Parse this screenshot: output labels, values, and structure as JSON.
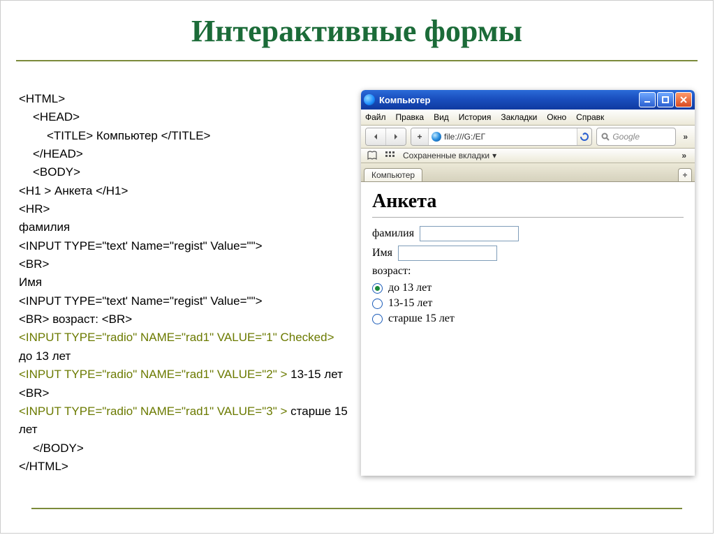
{
  "slide": {
    "title": "Интерактивные формы"
  },
  "code": {
    "l1": "<HTML>",
    "l2": "<HEAD>",
    "l3_a": "<TITLE> ",
    "l3_b": "Компьютер",
    "l3_c": " </TITLE>",
    "l4": "</HEAD>",
    "l5": "<BODY>",
    "l6_a": "<H1 > ",
    "l6_b": "Анкета",
    "l6_c": " </H1>",
    "l7": "<HR>",
    "l8": "фамилия",
    "l9": "<INPUT TYPE=\"text' Name=\"regist\" Value=\"\">",
    "l10": "<BR>",
    "l11": "Имя",
    "l12": "<INPUT TYPE=\"text' Name=\"regist\" Value=\"\">",
    "l13_a": "<BR>",
    "l13_b": " возраст: ",
    "l13_c": "<BR>",
    "l14": "<INPUT TYPE=\"radio\" NAME=\"rad1\" VALUE=\"1\" Checked>",
    "l14_t": " до 13 лет",
    "l15": "<INPUT TYPE=\"radio\" NAME=\"rad1\" VALUE=\"2\" >",
    "l15_t": " 13-15 лет ",
    "l15_br": "<BR>",
    "l16": "<INPUT TYPE=\"radio\" NAME=\"rad1\" VALUE=\"3\" >",
    "l16_t": " старше 15 лет",
    "l17": "</BODY>",
    "l18": "</HTML>"
  },
  "browser": {
    "window_title": "Компьютер",
    "menus": [
      "Файл",
      "Правка",
      "Вид",
      "История",
      "Закладки",
      "Окно",
      "Справк"
    ],
    "address_text": "file:///G:/ЕГ",
    "search_placeholder": "Google",
    "saved_tabs_label": "Сохраненные вкладки",
    "tab_label": "Компьютер",
    "more": "»",
    "page": {
      "h1": "Анкета",
      "surname_label": "фамилия",
      "name_label": "Имя",
      "age_label": "возраст:",
      "opt1": "до 13 лет",
      "opt2": "13-15 лет",
      "opt3": "старше 15 лет"
    }
  }
}
